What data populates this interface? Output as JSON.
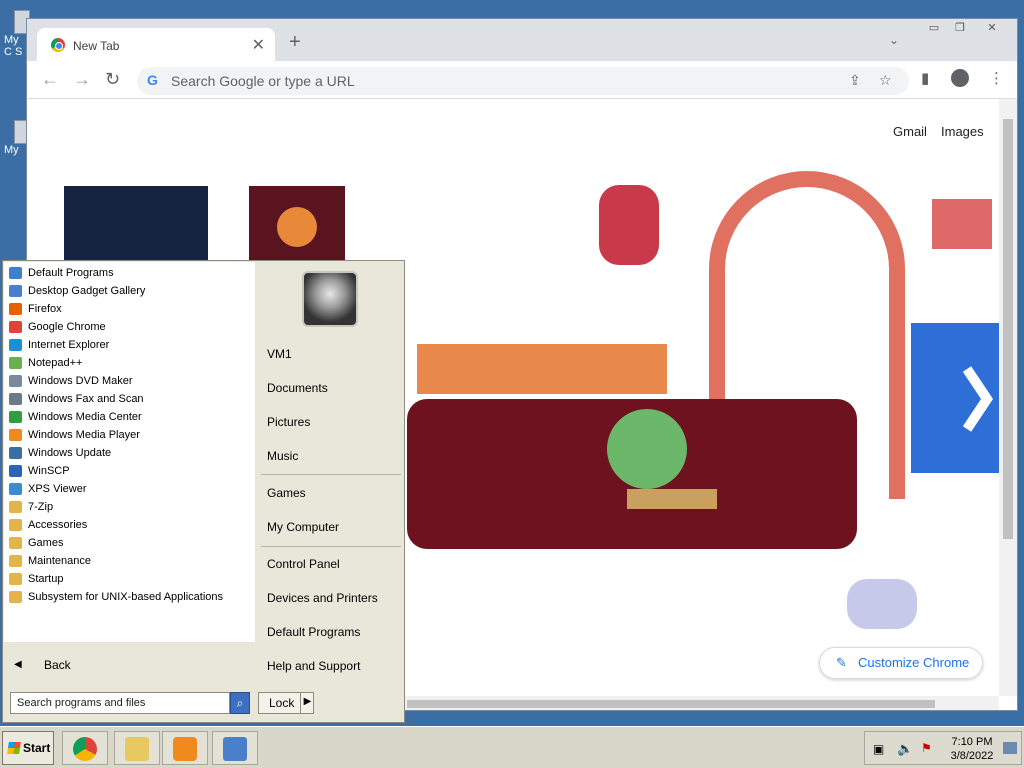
{
  "desktop": {
    "icons": [
      {
        "label": "My C S"
      },
      {
        "label": "My"
      }
    ]
  },
  "chrome": {
    "tab_title": "New Tab",
    "new_tab": "+",
    "omnibox_placeholder": "Search Google or type a URL",
    "links": {
      "gmail": "Gmail",
      "images": "Images"
    },
    "customize": "Customize Chrome"
  },
  "start_menu": {
    "programs": [
      {
        "label": "Default Programs",
        "color": "#3f7fcf"
      },
      {
        "label": "Desktop Gadget Gallery",
        "color": "#4a7fc9"
      },
      {
        "label": "Firefox",
        "color": "#e66000"
      },
      {
        "label": "Google Chrome",
        "color": "#db4437"
      },
      {
        "label": "Internet Explorer",
        "color": "#1c8fd6"
      },
      {
        "label": "Notepad++",
        "color": "#6ab04c"
      },
      {
        "label": "Windows DVD Maker",
        "color": "#7a8a9a"
      },
      {
        "label": "Windows Fax and Scan",
        "color": "#6a7a8a"
      },
      {
        "label": "Windows Media Center",
        "color": "#2e9e3e"
      },
      {
        "label": "Windows Media Player",
        "color": "#f08a1c"
      },
      {
        "label": "Windows Update",
        "color": "#3a6ea5"
      },
      {
        "label": "WinSCP",
        "color": "#2b64b4"
      },
      {
        "label": "XPS Viewer",
        "color": "#3b8bd4"
      },
      {
        "label": "7-Zip",
        "color": "#e2b44a"
      },
      {
        "label": "Accessories",
        "color": "#e2b44a"
      },
      {
        "label": "Games",
        "color": "#e2b44a"
      },
      {
        "label": "Maintenance",
        "color": "#e2b44a"
      },
      {
        "label": "Startup",
        "color": "#e2b44a"
      },
      {
        "label": "Subsystem for UNIX-based Applications",
        "color": "#e2b44a"
      }
    ],
    "back": "Back",
    "search_placeholder": "Search programs and files",
    "lock": "Lock",
    "right_items": [
      "VM1",
      "Documents",
      "Pictures",
      "Music",
      "Games",
      "My Computer",
      "Control Panel",
      "Devices and Printers",
      "Default Programs",
      "Help and Support"
    ]
  },
  "taskbar": {
    "start": "Start",
    "time": "7:10 PM",
    "date": "3/8/2022"
  }
}
